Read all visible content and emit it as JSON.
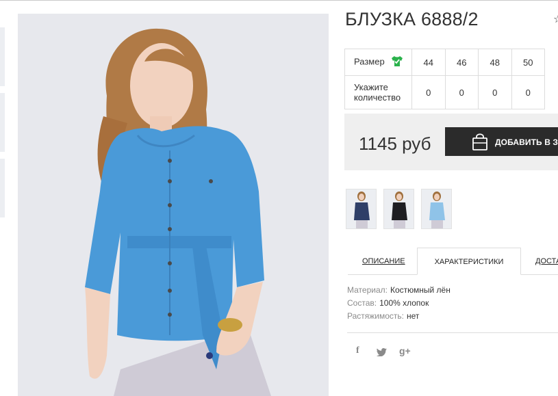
{
  "product": {
    "title": "БЛУЗКА 6888/2"
  },
  "size_table": {
    "size_label": "Размер",
    "qty_label_line1": "Укажите",
    "qty_label_line2": "количество",
    "sizes": [
      "44",
      "46",
      "48",
      "50"
    ],
    "quantities": [
      "0",
      "0",
      "0",
      "0"
    ]
  },
  "purchase": {
    "price": "1145 руб",
    "add_to_cart_label": "ДОБАВИТЬ В ЗАКАЗ"
  },
  "gallery": {
    "thumbnails": [
      "navy-blouse-thumbnail",
      "black-blouse-thumbnail",
      "light-blue-blouse-thumbnail"
    ]
  },
  "tabs": [
    {
      "label": "ОПИСАНИЕ",
      "active": false
    },
    {
      "label": "ХАРАКТЕРИСТИКИ",
      "active": true
    },
    {
      "label": "ДОСТАВКА",
      "active": false
    }
  ],
  "specs": [
    {
      "key": "Материал:",
      "value": "Костюмный лён"
    },
    {
      "key": "Состав:",
      "value": "100% хлопок"
    },
    {
      "key": "Растяжимость:",
      "value": "нет"
    }
  ],
  "social": {
    "facebook": "f",
    "twitter": "twitter-icon",
    "google_plus": "g+"
  },
  "colors": {
    "button_bg": "#2b2b2b",
    "price_box_bg": "#efefef",
    "size_icon_green": "#2bb24c",
    "blouse_blue": "#4a9ad8"
  }
}
